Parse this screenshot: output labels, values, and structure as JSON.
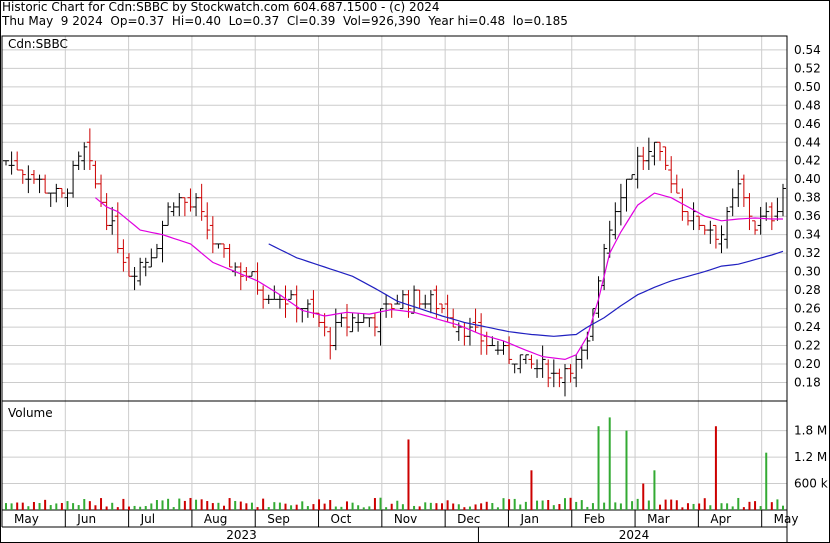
{
  "header": {
    "line1": "Historic Chart for Cdn:SBBC by Stockwatch.com 604.687.1500 - (c) 2024",
    "line2": "Thu May  9 2024  Op=0.37  Hi=0.40  Lo=0.37  Cl=0.39  Vol=926,390  Year hi=0.48  lo=0.185"
  },
  "colors": {
    "up": "#000000",
    "down": "#cc0000",
    "ma_short": "#e000e0",
    "ma_long": "#2020c0",
    "vol_up": "#33aa33",
    "vol_down": "#cc0000",
    "vol_flat": "#aaaaaa",
    "grid": "#cccccc"
  },
  "chart_data": [
    {
      "type": "ohlc",
      "panel_label": "Cdn:SBBC",
      "x_months": [
        "May",
        "Jun",
        "Jul",
        "Aug",
        "Sep",
        "Oct",
        "Nov",
        "Dec",
        "Jan",
        "Feb",
        "Mar",
        "Apr",
        "May"
      ],
      "x_years": [
        "2023",
        "2024"
      ],
      "y_ticks": [
        "0.54",
        "0.52",
        "0.50",
        "0.48",
        "0.46",
        "0.44",
        "0.42",
        "0.40",
        "0.38",
        "0.36",
        "0.34",
        "0.32",
        "0.30",
        "0.28",
        "0.26",
        "0.24",
        "0.22",
        "0.20",
        "0.18"
      ],
      "ylim": [
        0.16,
        0.555
      ],
      "price_anchors": [
        [
          0,
          0.42
        ],
        [
          5,
          0.4
        ],
        [
          10,
          0.38
        ],
        [
          14,
          0.43
        ],
        [
          18,
          0.36
        ],
        [
          22,
          0.3
        ],
        [
          26,
          0.32
        ],
        [
          30,
          0.38
        ],
        [
          34,
          0.37
        ],
        [
          38,
          0.32
        ],
        [
          42,
          0.3
        ],
        [
          46,
          0.28
        ],
        [
          50,
          0.27
        ],
        [
          54,
          0.26
        ],
        [
          58,
          0.23
        ],
        [
          62,
          0.25
        ],
        [
          66,
          0.25
        ],
        [
          70,
          0.27
        ],
        [
          74,
          0.27
        ],
        [
          78,
          0.26
        ],
        [
          82,
          0.24
        ],
        [
          86,
          0.22
        ],
        [
          90,
          0.21
        ],
        [
          94,
          0.2
        ],
        [
          98,
          0.19
        ],
        [
          102,
          0.2
        ],
        [
          104,
          0.22
        ],
        [
          107,
          0.33
        ],
        [
          110,
          0.39
        ],
        [
          113,
          0.42
        ],
        [
          116,
          0.43
        ],
        [
          119,
          0.4
        ],
        [
          122,
          0.36
        ],
        [
          125,
          0.35
        ],
        [
          128,
          0.34
        ],
        [
          131,
          0.39
        ],
        [
          134,
          0.35
        ],
        [
          137,
          0.36
        ],
        [
          139,
          0.39
        ]
      ],
      "ma_short_anchors": [
        [
          16,
          0.38
        ],
        [
          18,
          0.37
        ],
        [
          20,
          0.365
        ],
        [
          24,
          0.345
        ],
        [
          28,
          0.34
        ],
        [
          33,
          0.33
        ],
        [
          37,
          0.31
        ],
        [
          41,
          0.3
        ],
        [
          45,
          0.29
        ],
        [
          49,
          0.275
        ],
        [
          53,
          0.258
        ],
        [
          57,
          0.252
        ],
        [
          61,
          0.256
        ],
        [
          65,
          0.254
        ],
        [
          69,
          0.259
        ],
        [
          73,
          0.256
        ],
        [
          77,
          0.249
        ],
        [
          81,
          0.242
        ],
        [
          85,
          0.232
        ],
        [
          89,
          0.225
        ],
        [
          93,
          0.215
        ],
        [
          96,
          0.208
        ],
        [
          100,
          0.205
        ],
        [
          102,
          0.21
        ],
        [
          104,
          0.23
        ],
        [
          106,
          0.27
        ],
        [
          108,
          0.32
        ],
        [
          110,
          0.343
        ],
        [
          113,
          0.372
        ],
        [
          116,
          0.385
        ],
        [
          119,
          0.38
        ],
        [
          122,
          0.37
        ],
        [
          125,
          0.36
        ],
        [
          128,
          0.355
        ],
        [
          131,
          0.357
        ],
        [
          134,
          0.358
        ],
        [
          137,
          0.357
        ],
        [
          139,
          0.357
        ]
      ],
      "ma_long_anchors": [
        [
          47,
          0.33
        ],
        [
          52,
          0.315
        ],
        [
          57,
          0.305
        ],
        [
          62,
          0.295
        ],
        [
          66,
          0.282
        ],
        [
          70,
          0.268
        ],
        [
          74,
          0.26
        ],
        [
          78,
          0.252
        ],
        [
          82,
          0.245
        ],
        [
          86,
          0.24
        ],
        [
          90,
          0.235
        ],
        [
          94,
          0.232
        ],
        [
          98,
          0.23
        ],
        [
          102,
          0.232
        ],
        [
          104,
          0.24
        ],
        [
          107,
          0.25
        ],
        [
          110,
          0.263
        ],
        [
          113,
          0.275
        ],
        [
          116,
          0.283
        ],
        [
          119,
          0.29
        ],
        [
          122,
          0.295
        ],
        [
          125,
          0.3
        ],
        [
          128,
          0.306
        ],
        [
          131,
          0.308
        ],
        [
          134,
          0.313
        ],
        [
          137,
          0.318
        ],
        [
          139,
          0.322
        ]
      ]
    },
    {
      "type": "bar",
      "panel_label": "Volume",
      "y_ticks": [
        "1.8 M",
        "1.2 M",
        "600 k"
      ],
      "ylim": [
        0,
        2200000
      ],
      "volume_spikes": [
        [
          72,
          1600000
        ],
        [
          94,
          900000
        ],
        [
          106,
          1900000
        ],
        [
          108,
          2100000
        ],
        [
          111,
          1800000
        ],
        [
          114,
          600000
        ],
        [
          116,
          900000
        ],
        [
          127,
          1900000
        ],
        [
          136,
          1300000
        ]
      ]
    }
  ]
}
